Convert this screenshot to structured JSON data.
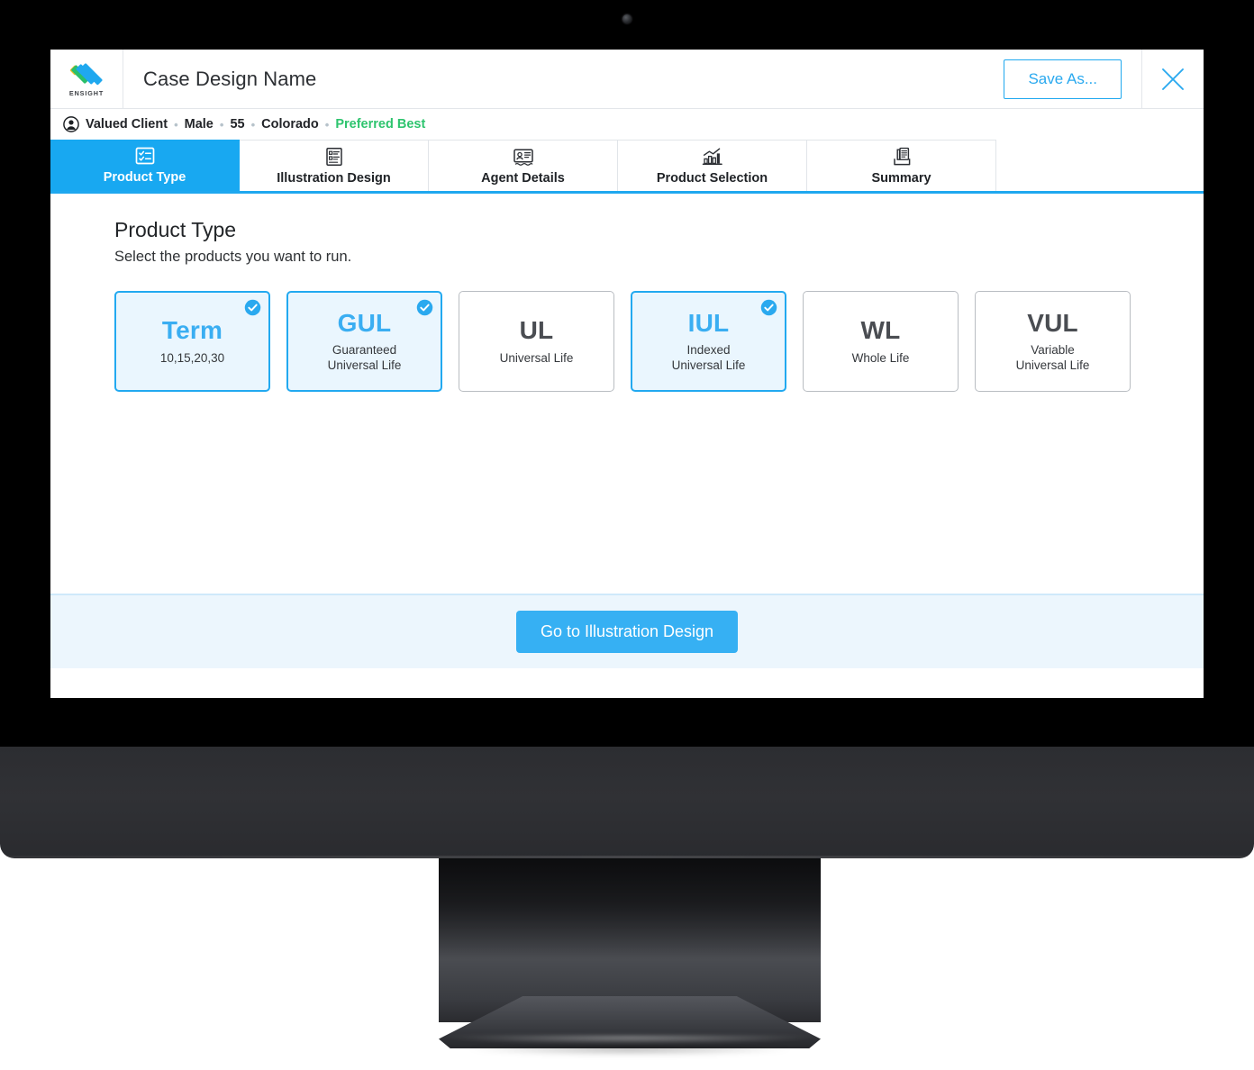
{
  "brand": {
    "logo_icon": "ensight-chevron-logo",
    "wordmark": "ENSIGHT",
    "accent_blue": "#18a8f1",
    "accent_green": "#2ec46e",
    "logo_colors": [
      "#f5c game",
      "#2bbf6a",
      "#1fa8ef"
    ]
  },
  "header": {
    "case_title": "Case Design Name",
    "save_as_label": "Save As...",
    "close_icon": "close-icon"
  },
  "client_bar": {
    "avatar_icon": "user-avatar-icon",
    "name": "Valued Client",
    "gender": "Male",
    "age": "55",
    "state": "Colorado",
    "risk_class": "Preferred Best",
    "separator": "•"
  },
  "tabs": [
    {
      "label": "Product Type",
      "icon": "checklist-icon",
      "active": true
    },
    {
      "label": "Illustration Design",
      "icon": "form-list-icon",
      "active": false
    },
    {
      "label": "Agent Details",
      "icon": "id-card-icon",
      "active": false
    },
    {
      "label": "Product Selection",
      "icon": "bar-chart-icon",
      "active": false
    },
    {
      "label": "Summary",
      "icon": "documents-tray-icon",
      "active": false
    }
  ],
  "main": {
    "title": "Product Type",
    "subtitle": "Select the products you want to run.",
    "products": [
      {
        "code": "Term",
        "desc": "10,15,20,30",
        "selected": true
      },
      {
        "code": "GUL",
        "desc": "Guaranteed\nUniversal Life",
        "selected": true
      },
      {
        "code": "UL",
        "desc": "Universal Life",
        "selected": false
      },
      {
        "code": "IUL",
        "desc": "Indexed\nUniversal Life",
        "selected": true
      },
      {
        "code": "WL",
        "desc": "Whole Life",
        "selected": false
      },
      {
        "code": "VUL",
        "desc": "Variable\nUniversal Life",
        "selected": false
      }
    ]
  },
  "footer": {
    "primary_label": "Go to Illustration Design"
  }
}
